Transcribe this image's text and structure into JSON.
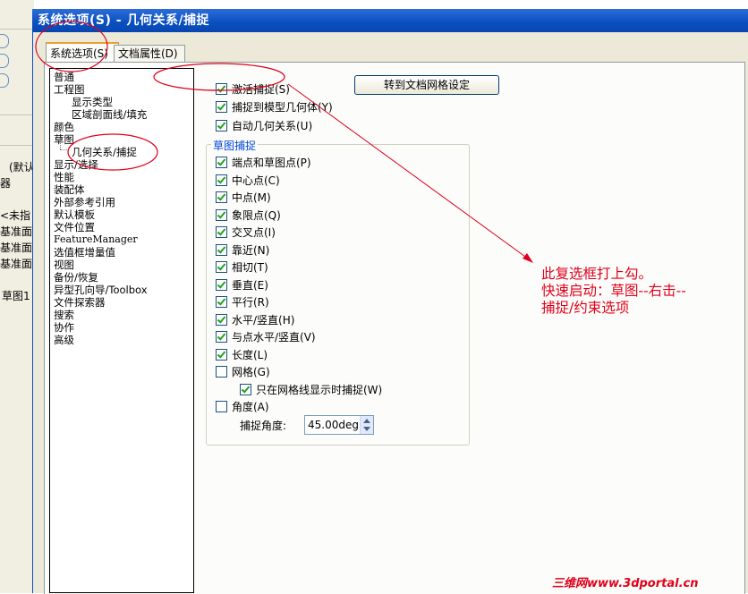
{
  "window": {
    "title": "系统选项(S) - 几何关系/捕捉"
  },
  "background": {
    "items": [
      "(默认",
      "器",
      "<未指",
      "基准面",
      "基准面",
      "基准面",
      "草图1"
    ]
  },
  "tabs": [
    {
      "label": "系统选项(S)",
      "active": true
    },
    {
      "label": "文档属性(D)",
      "active": false
    }
  ],
  "tree": {
    "items": [
      "普通",
      "工程图",
      "显示类型",
      "区域剖面线/填充",
      "颜色",
      "草图",
      "几何关系/捕捉",
      "显示/选择",
      "性能",
      "装配体",
      "外部参考引用",
      "默认模板",
      "文件位置",
      "FeatureManager",
      "选值框增量值",
      "视图",
      "备份/恢复",
      "异型孔向导/Toolbox",
      "文件探索器",
      "搜索",
      "协作",
      "高级"
    ]
  },
  "options": {
    "enable_snap": {
      "label": "激活捕捉(S)",
      "checked": true
    },
    "snap_model": {
      "label": "捕捉到模型几何体(Y)",
      "checked": true
    },
    "auto_relations": {
      "label": "自动几何关系(U)",
      "checked": true
    },
    "doc_grid_button": "转到文档网格设定"
  },
  "snap_group": {
    "title": "草图捕捉",
    "items": [
      {
        "label": "端点和草图点(P)",
        "checked": true
      },
      {
        "label": "中心点(C)",
        "checked": true
      },
      {
        "label": "中点(M)",
        "checked": true
      },
      {
        "label": "象限点(Q)",
        "checked": true
      },
      {
        "label": "交叉点(I)",
        "checked": true
      },
      {
        "label": "靠近(N)",
        "checked": true
      },
      {
        "label": "相切(T)",
        "checked": true
      },
      {
        "label": "垂直(E)",
        "checked": true
      },
      {
        "label": "平行(R)",
        "checked": true
      },
      {
        "label": "水平/竖直(H)",
        "checked": true
      },
      {
        "label": "与点水平/竖直(V)",
        "checked": true
      },
      {
        "label": "长度(L)",
        "checked": true
      },
      {
        "label": "网格(G)",
        "checked": false
      },
      {
        "label": "只在网格线显示时捕捉(W)",
        "checked": true
      },
      {
        "label": "角度(A)",
        "checked": false
      }
    ],
    "angle_label": "捕捉角度:",
    "angle_value": "45.00deg"
  },
  "annotation": {
    "line1": "此复选框打上勾。",
    "line2": "快速启动：草图--右击--",
    "line3": "捕捉/约束选项"
  },
  "watermark": {
    "brand": "三维网",
    "url": "www.3dportal.cn"
  },
  "colors": {
    "annotation": "#e0001a",
    "titlebar": "#0a4fc0",
    "check": "#21a121"
  }
}
